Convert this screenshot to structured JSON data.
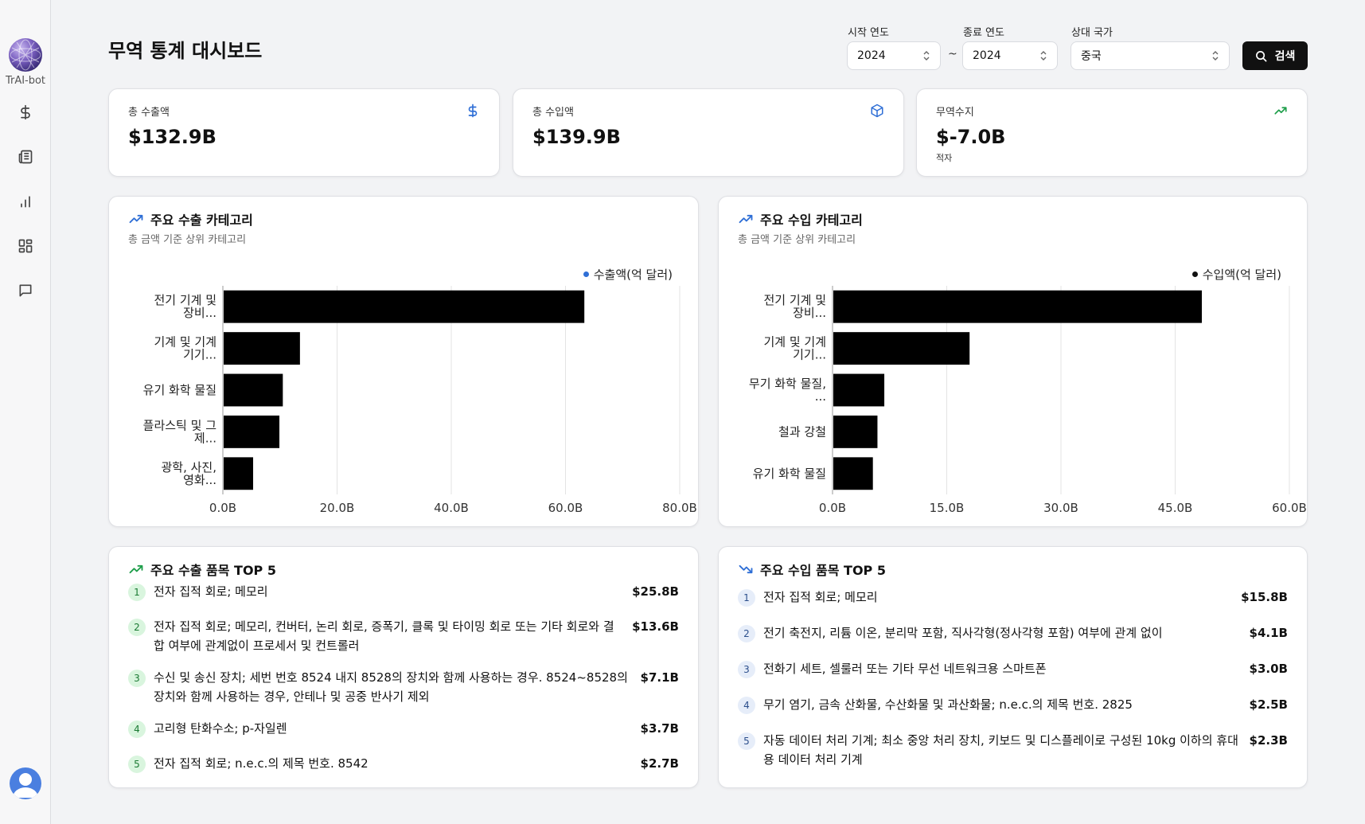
{
  "app": {
    "logo_text": "TrAI-bot"
  },
  "sidebar": {
    "items": [
      {
        "name": "dollar"
      },
      {
        "name": "news"
      },
      {
        "name": "chart"
      },
      {
        "name": "dashboard"
      },
      {
        "name": "chat"
      }
    ]
  },
  "header": {
    "title": "무역 통계 대시보드",
    "start_year_label": "시작 연도",
    "start_year_value": "2024",
    "end_year_label": "종료 연도",
    "end_year_value": "2024",
    "separator": "~",
    "partner_label": "상대 국가",
    "partner_value": "중국",
    "search_label": "검색"
  },
  "stats": {
    "export": {
      "label": "총 수출액",
      "value": "$132.9B",
      "icon": "dollar-icon",
      "color": "#2f6fd6"
    },
    "import": {
      "label": "총 수입액",
      "value": "$139.9B",
      "icon": "box-icon",
      "color": "#2f6fd6"
    },
    "balance": {
      "label": "무역수지",
      "value": "$-7.0B",
      "sub": "적자",
      "icon": "trending-up-icon",
      "color": "#1e9e4a"
    }
  },
  "export_chart_panel": {
    "title": "주요 수출 카테고리",
    "subtitle": "총 금액 기준 상위 카테고리",
    "legend": "수출액(억 달러)",
    "legend_color": "#2f6fd6"
  },
  "import_chart_panel": {
    "title": "주요 수입 카테고리",
    "subtitle": "총 금액 기준 상위 카테고리",
    "legend": "수입액(억 달러)",
    "legend_color": "#111111"
  },
  "chart_data": [
    {
      "type": "bar",
      "orientation": "horizontal",
      "categories": [
        "전기 기계 및 장비...",
        "기계 및 기계 기기...",
        "유기 화학 물질",
        "플라스틱 및 그 제...",
        "광학, 사진, 영화..."
      ],
      "category_lines": [
        [
          "전기 기계 및",
          "장비..."
        ],
        [
          "기계 및 기계",
          "기기..."
        ],
        [
          "유기 화학 물질"
        ],
        [
          "플라스틱 및 그",
          "제..."
        ],
        [
          "광학, 사진,",
          "영화..."
        ]
      ],
      "values": [
        63.3,
        13.5,
        10.5,
        9.9,
        5.3
      ],
      "xlim": [
        0,
        80
      ],
      "ticks": [
        0,
        20,
        40,
        60,
        80
      ],
      "tick_labels": [
        "0.0B",
        "20.0B",
        "40.0B",
        "60.0B",
        "80.0B"
      ],
      "series_name": "수출액(억 달러)",
      "grid": "vertical",
      "legend_position": "top-right"
    },
    {
      "type": "bar",
      "orientation": "horizontal",
      "categories": [
        "전기 기계 및 장비...",
        "기계 및 기계 기기...",
        "무기 화학 물질, ...",
        "철과 강철",
        "유기 화학 물질"
      ],
      "category_lines": [
        [
          "전기 기계 및",
          "장비..."
        ],
        [
          "기계 및 기계",
          "기기..."
        ],
        [
          "무기 화학 물질,",
          "..."
        ],
        [
          "철과 강철"
        ],
        [
          "유기 화학 물질"
        ]
      ],
      "values": [
        48.5,
        18.0,
        6.8,
        5.9,
        5.3
      ],
      "xlim": [
        0,
        60
      ],
      "ticks": [
        0,
        15,
        30,
        45,
        60
      ],
      "tick_labels": [
        "0.0B",
        "15.0B",
        "30.0B",
        "45.0B",
        "60.0B"
      ],
      "series_name": "수입액(억 달러)",
      "grid": "vertical",
      "legend_position": "top-right"
    }
  ],
  "top_exports": {
    "title": "주요 수출 품목 TOP 5",
    "items": [
      {
        "rank": "1",
        "name": "전자 집적 회로; 메모리",
        "value": "$25.8B"
      },
      {
        "rank": "2",
        "name": "전자 집적 회로; 메모리, 컨버터, 논리 회로, 증폭기, 클록 및 타이밍 회로 또는 기타 회로와 결합 여부에 관계없이 프로세서 및 컨트롤러",
        "value": "$13.6B"
      },
      {
        "rank": "3",
        "name": "수신 및 송신 장치; 세번 번호 8524 내지 8528의 장치와 함께 사용하는 경우. 8524~8528의 장치와 함께 사용하는 경우, 안테나 및 공중 반사기 제외",
        "value": "$7.1B"
      },
      {
        "rank": "4",
        "name": "고리형 탄화수소; p-자일렌",
        "value": "$3.7B"
      },
      {
        "rank": "5",
        "name": "전자 집적 회로; n.e.c.의 제목 번호. 8542",
        "value": "$2.7B"
      }
    ]
  },
  "top_imports": {
    "title": "주요 수입 품목 TOP 5",
    "items": [
      {
        "rank": "1",
        "name": "전자 집적 회로; 메모리",
        "value": "$15.8B"
      },
      {
        "rank": "2",
        "name": "전기 축전지, 리튬 이온, 분리막 포함, 직사각형(정사각형 포함) 여부에 관계 없이",
        "value": "$4.1B"
      },
      {
        "rank": "3",
        "name": "전화기 세트, 셀룰러 또는 기타 무선 네트워크용 스마트폰",
        "value": "$3.0B"
      },
      {
        "rank": "4",
        "name": "무기 염기, 금속 산화물, 수산화물 및 과산화물; n.e.c.의 제목 번호. 2825",
        "value": "$2.5B"
      },
      {
        "rank": "5",
        "name": "자동 데이터 처리 기계; 최소 중앙 처리 장치, 키보드 및 디스플레이로 구성된 10kg 이하의 휴대용 데이터 처리 기계",
        "value": "$2.3B"
      }
    ]
  }
}
